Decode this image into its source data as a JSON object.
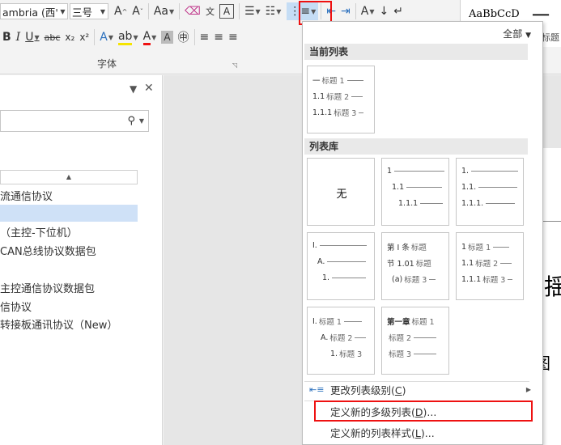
{
  "ribbon": {
    "font_name": "ambria (西'",
    "font_size": "三号",
    "aa_label": "Aa",
    "group_label": "字体",
    "style_preview": {
      "name": "AaBbCcD",
      "big_char": "一",
      "label": "标题"
    }
  },
  "nav_pane": {
    "close_glyph": "✕",
    "tab_label": "",
    "items": [
      {
        "text": "流通信协议",
        "selected": false
      },
      {
        "text": "",
        "selected": true
      },
      {
        "text": "（主控-下位机）",
        "selected": false
      },
      {
        "text": "CAN总线协议数据包",
        "selected": false
      },
      {
        "text": "主控通信协议数据包",
        "selected": false
      },
      {
        "text": "信协议",
        "selected": false
      },
      {
        "text": "转接板通讯协议（New）",
        "selected": false
      }
    ]
  },
  "document": {
    "char1": "揺",
    "char2": "图"
  },
  "list_panel": {
    "filter_label": "全部",
    "current_section": "当前列表",
    "library_section": "列表库",
    "current_list": {
      "lines": [
        {
          "level": "一",
          "text": "标题 1"
        },
        {
          "level": "1.1",
          "text": "标题 2"
        },
        {
          "level": "1.1.1",
          "text": "标题 3"
        }
      ]
    },
    "library": [
      {
        "none_label": "无"
      },
      {
        "lines": [
          {
            "level": "1",
            "text": ""
          },
          {
            "level": "1.1",
            "text": ""
          },
          {
            "level": "1.1.1",
            "text": ""
          }
        ]
      },
      {
        "lines": [
          {
            "level": "1.",
            "text": ""
          },
          {
            "level": "1.1.",
            "text": ""
          },
          {
            "level": "1.1.1.",
            "text": ""
          }
        ]
      },
      {
        "lines": [
          {
            "level": "I.",
            "text": ""
          },
          {
            "level": "A.",
            "text": ""
          },
          {
            "level": "1.",
            "text": ""
          }
        ]
      },
      {
        "lines": [
          {
            "level": "第 I 条",
            "text": "标题"
          },
          {
            "level": "节 1.01",
            "text": "标题"
          },
          {
            "level": "(a)",
            "text": "标题 3"
          }
        ]
      },
      {
        "lines": [
          {
            "level": "1",
            "text": "标题 1"
          },
          {
            "level": "1.1",
            "text": "标题 2"
          },
          {
            "level": "1.1.1",
            "text": "标题 3"
          }
        ]
      },
      {
        "lines": [
          {
            "level": "I.",
            "text": "标题 1"
          },
          {
            "level": "A.",
            "text": "标题 2"
          },
          {
            "level": "1.",
            "text": "标题 3"
          }
        ]
      },
      {
        "lines": [
          {
            "level": "第一章",
            "text": "标题 1"
          },
          {
            "level": "",
            "text": "标题 2"
          },
          {
            "level": "",
            "text": "标题 3"
          }
        ]
      }
    ],
    "menu": [
      {
        "label": "更改列表级别",
        "accel": "C",
        "suffix": ")",
        "has_submenu": true
      },
      {
        "label": "定义新的多级列表",
        "accel": "D",
        "suffix": ")...",
        "has_submenu": false
      },
      {
        "label": "定义新的列表样式",
        "accel": "L",
        "suffix": ")...",
        "has_submenu": false
      }
    ]
  },
  "colors": {
    "highlight": "#e11111",
    "selected": "#cfe1f7",
    "section_bg": "#e9e9e9"
  }
}
